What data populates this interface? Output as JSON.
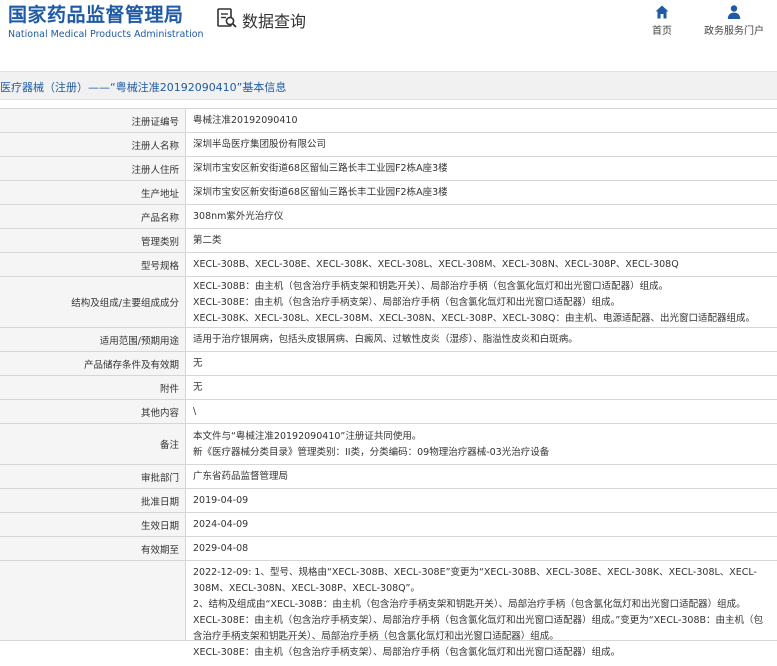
{
  "header": {
    "logo_cn": "国家药品监督管理局",
    "logo_en": "National Medical Products Administration",
    "query_label": "数据查询",
    "nav_home": "首页",
    "nav_portal": "政务服务门户"
  },
  "breadcrumb": "医疗器械（注册）——“粤械注准20192090410”基本信息",
  "rows": [
    {
      "label": "注册证编号",
      "lines": [
        "粤械注准20192090410"
      ]
    },
    {
      "label": "注册人名称",
      "lines": [
        "深圳半岛医疗集团股份有限公司"
      ]
    },
    {
      "label": "注册人住所",
      "lines": [
        "深圳市宝安区新安街道68区留仙三路长丰工业园F2栋A座3楼"
      ]
    },
    {
      "label": "生产地址",
      "lines": [
        "深圳市宝安区新安街道68区留仙三路长丰工业园F2栋A座3楼"
      ]
    },
    {
      "label": "产品名称",
      "lines": [
        "308nm紫外光治疗仪"
      ]
    },
    {
      "label": "管理类别",
      "lines": [
        "第二类"
      ]
    },
    {
      "label": "型号规格",
      "lines": [
        "XECL-308B、XECL-308E、XECL-308K、XECL-308L、XECL-308M、XECL-308N、XECL-308P、XECL-308Q"
      ]
    },
    {
      "label": "结构及组成/主要组成成分",
      "lines": [
        "XECL-308B：由主机（包含治疗手柄支架和钥匙开关）、局部治疗手柄（包含氯化氙灯和出光窗口适配器）组成。",
        "XECL-308E：由主机（包含治疗手柄支架）、局部治疗手柄（包含氯化氙灯和出光窗口适配器）组成。",
        "XECL-308K、XECL-308L、XECL-308M、XECL-308N、XECL-308P、XECL-308Q：由主机、电源适配器、出光窗口适配器组成。"
      ]
    },
    {
      "label": "适用范围/预期用途",
      "lines": [
        "适用于治疗银屑病，包括头皮银屑病、白癜风、过敏性皮炎（湿疹）、脂溢性皮炎和白斑病。"
      ]
    },
    {
      "label": "产品储存条件及有效期",
      "lines": [
        "无"
      ]
    },
    {
      "label": "附件",
      "lines": [
        "无"
      ]
    },
    {
      "label": "其他内容",
      "lines": [
        "\\"
      ]
    },
    {
      "label": "备注",
      "lines": [
        "本文件与“粤械注准20192090410”注册证共同使用。",
        "新《医疗器械分类目录》管理类别：II类，分类编码：09物理治疗器械-03光治疗设备"
      ]
    },
    {
      "label": "审批部门",
      "lines": [
        "广东省药品监督管理局"
      ]
    },
    {
      "label": "批准日期",
      "lines": [
        "2019-04-09"
      ]
    },
    {
      "label": "生效日期",
      "lines": [
        "2024-04-09"
      ]
    },
    {
      "label": "有效期至",
      "lines": [
        "2029-04-08"
      ]
    },
    {
      "label": "",
      "lines": [
        "2022-12-09: 1、型号、规格由“XECL-308B、XECL-308E”变更为“XECL-308B、XECL-308E、XECL-308K、XECL-308L、XECL-308M、XECL-308N、XECL-308P、XECL-308Q”。",
        "2、结构及组成由“XECL-308B：由主机（包含治疗手柄支架和钥匙开关）、局部治疗手柄（包含氯化氙灯和出光窗口适配器）组成。XECL-308E：由主机（包含治疗手柄支架）、局部治疗手柄（包含氯化氙灯和出光窗口适配器）组成。”变更为“XECL-308B：由主机（包含治疗手柄支架和钥匙开关）、局部治疗手柄（包含氯化氙灯和出光窗口适配器）组成。",
        "XECL-308E：由主机（包含治疗手柄支架）、局部治疗手柄（包含氯化氙灯和出光窗口适配器）组成。"
      ]
    }
  ]
}
